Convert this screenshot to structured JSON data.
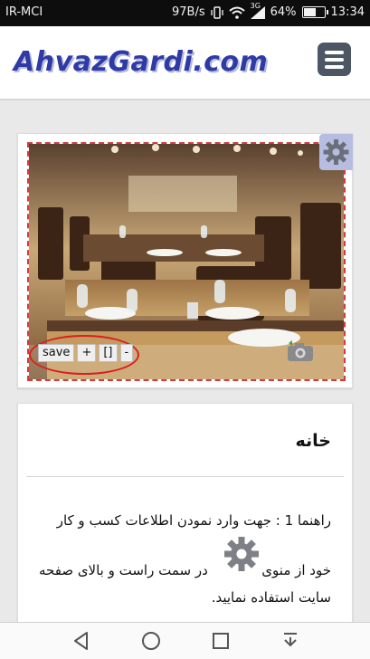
{
  "status_bar": {
    "carrier": "IR-MCI",
    "net_speed": "97B/s",
    "signal_label": "3G",
    "battery": "64%",
    "battery_level": 0.64,
    "time": "13:34"
  },
  "header": {
    "logo_text": "AhvazGardi.com",
    "menu_icon": "hamburger-icon",
    "colors": {
      "logo": "#2e3aa6",
      "menu_button": "#4c5664"
    }
  },
  "image_card": {
    "settings_icon": "gear-icon",
    "toolbar": {
      "save_label": "save",
      "plus_label": "+",
      "brackets_label": "[]",
      "minus_label": "-"
    },
    "camera_icon": "camera-icon"
  },
  "info_card": {
    "title": "خانه",
    "line1": "راهنما 1 : جهت وارد نمودن اطلاعات کسب و کار",
    "line2_before": "خود از منوی",
    "line2_after": "در سمت راست و بالای صفحه",
    "line3": "سایت استفاده نمایید.",
    "inline_icon": "gear-icon"
  },
  "nav_bar": {
    "buttons": [
      "back-icon",
      "home-icon",
      "recents-icon",
      "notification-pull-icon"
    ]
  }
}
